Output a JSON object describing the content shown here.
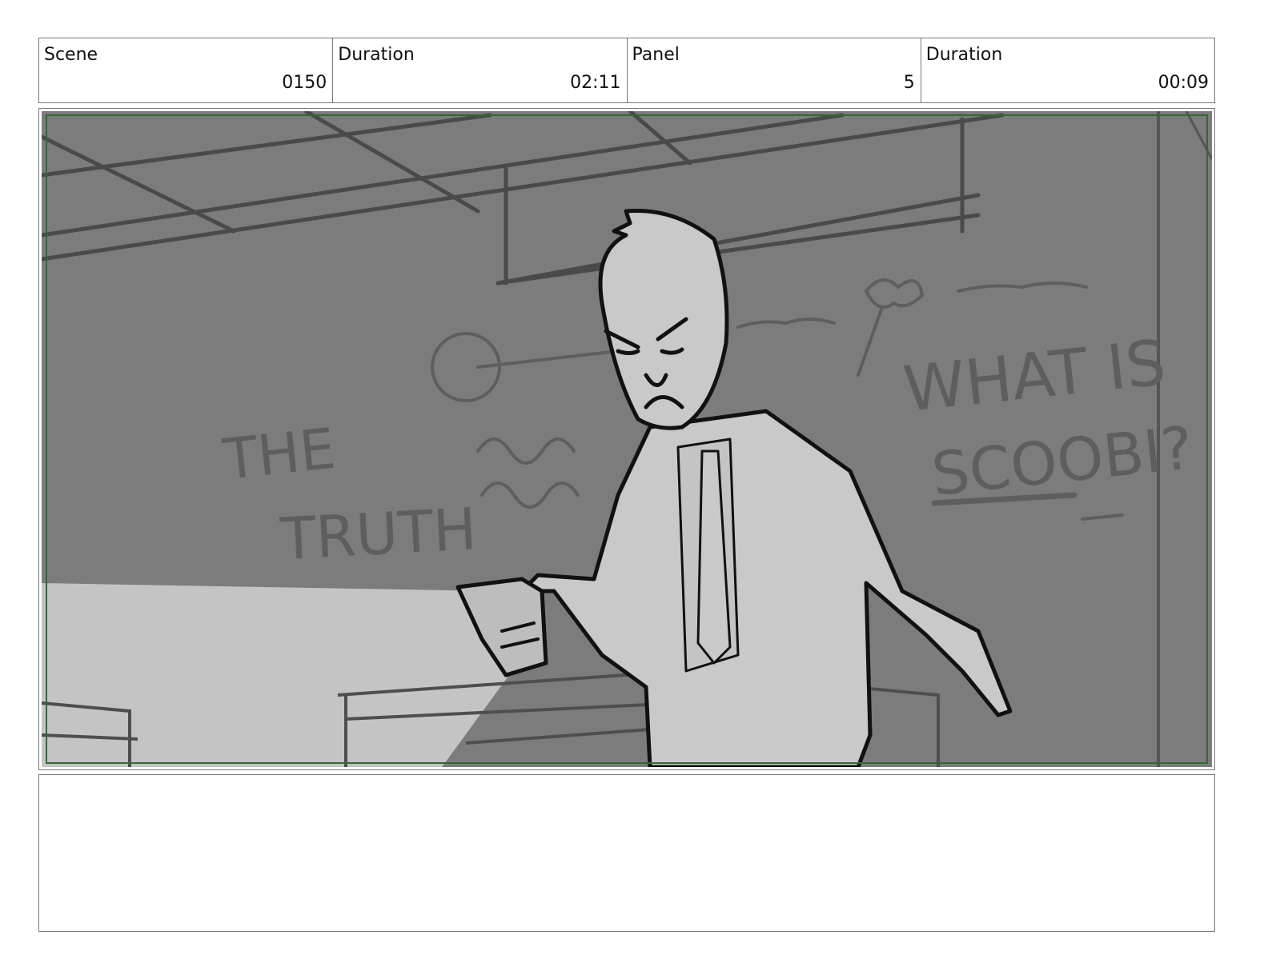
{
  "header": {
    "scene_label": "Scene",
    "scene_value": "0150",
    "scene_duration_label": "Duration",
    "scene_duration_value": "02:11",
    "panel_label": "Panel",
    "panel_value": "5",
    "panel_duration_label": "Duration",
    "panel_duration_value": "00:09"
  },
  "drawing": {
    "board_text_1": "THE",
    "board_text_2": "TRUTH",
    "board_text_3": "WHAT IS",
    "board_text_4": "SCOOBI?",
    "safe_frame_color": "#2e6b2e",
    "background_color": "#7c7c7c",
    "figure_color": "#c9c9c9"
  },
  "notes": {
    "text": ""
  }
}
